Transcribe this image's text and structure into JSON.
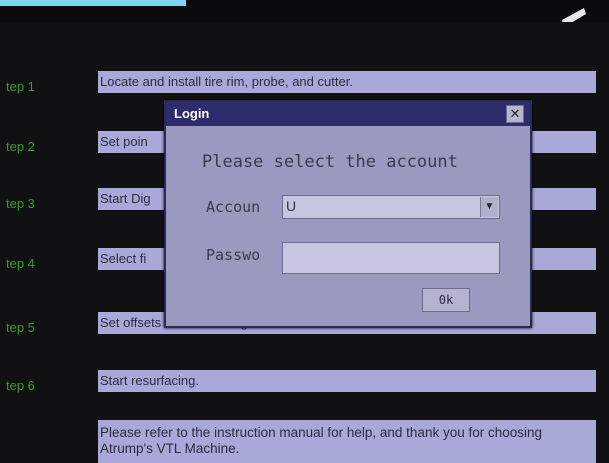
{
  "steps": [
    {
      "label": "tep 1",
      "text": "Locate and install tire rim, probe, and cutter."
    },
    {
      "label": "tep 2",
      "text": "Set poin"
    },
    {
      "label": "tep 3",
      "text": "Start Dig"
    },
    {
      "label": "tep 4",
      "text": "Select fi"
    },
    {
      "label": "tep 5",
      "text": "Set offsets for resurfacing."
    },
    {
      "label": "tep 6",
      "text": "Start resurfacing."
    }
  ],
  "info": "Please refer to the instruction manual for help, and thank you for choosing Atrump's VTL Machine.",
  "login": {
    "title": "Login",
    "close": "✕",
    "prompt": "Please select the account",
    "account_label": "Accoun",
    "account_value": "U",
    "password_label": "Passwo",
    "password_value": "",
    "ok": "0k"
  },
  "icons": {
    "corner": "pencil-icon",
    "dropdown": "chevron-down-icon"
  },
  "colors": {
    "screen": "#111114",
    "step_label": "#3c9a2e",
    "box": "#a9a9d9",
    "title_bar": "#2d2d6e",
    "dialog": "#9a99c0"
  }
}
